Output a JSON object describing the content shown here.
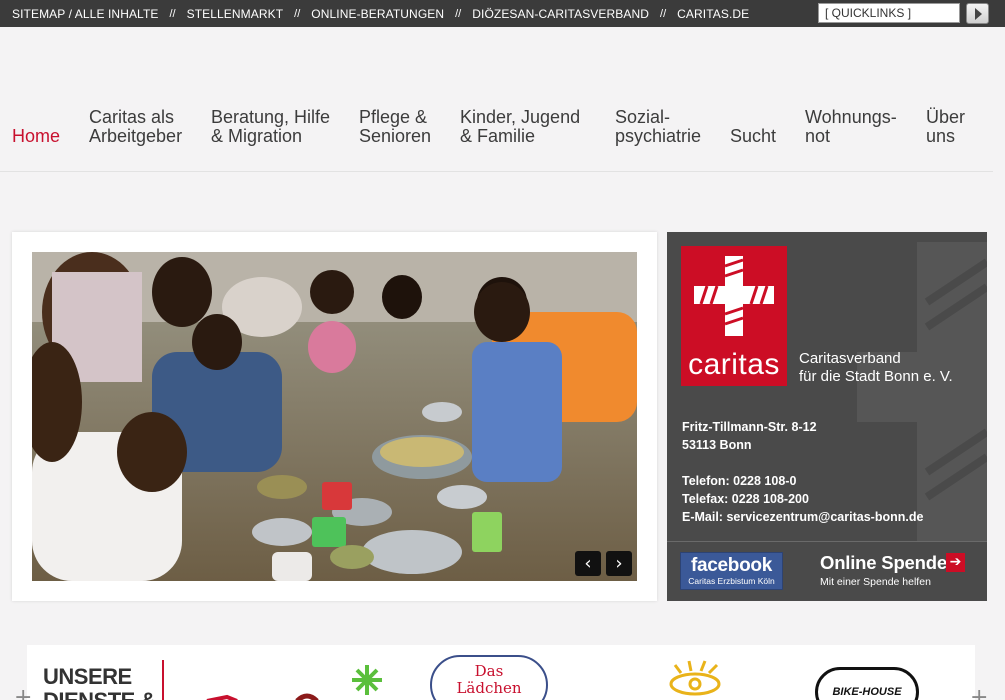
{
  "topbar": {
    "links": [
      "SITEMAP / ALLE INHALTE",
      "STELLENMARKT",
      "ONLINE-BERATUNGEN",
      "DIÖZESAN-CARITASVERBAND",
      "CARITAS.DE"
    ],
    "separator": "//",
    "quicklinks_value": "[ QUICKLINKS ]"
  },
  "nav": {
    "items": [
      {
        "line1": "Home",
        "line2": ""
      },
      {
        "line1": "Caritas als",
        "line2": "Arbeitgeber"
      },
      {
        "line1": "Beratung, Hilfe",
        "line2": "& Migration"
      },
      {
        "line1": "Pflege &",
        "line2": "Senioren"
      },
      {
        "line1": "Kinder, Jugend",
        "line2": "& Familie"
      },
      {
        "line1": "Sozial-",
        "line2": "psychiatrie"
      },
      {
        "line1": "Sucht",
        "line2": ""
      },
      {
        "line1": "Wohnungs-",
        "line2": "not"
      },
      {
        "line1": "Über",
        "line2": "uns"
      }
    ]
  },
  "slider": {
    "prev": "‹",
    "next": "›"
  },
  "info": {
    "logo_text": "caritas",
    "org_line1": "Caritasverband",
    "org_line2": "für die Stadt Bonn e. V.",
    "street": "Fritz-Tillmann-Str. 8-12",
    "city": "53113 Bonn",
    "phone": "Telefon: 0228 108-0",
    "fax": "Telefax: 0228 108-200",
    "email": "E-Mail: servicezentrum@caritas-bonn.de",
    "facebook_title": "facebook",
    "facebook_sub": "Caritas Erzbistum Köln",
    "spenden_title": "Online Spenden",
    "spenden_sub": "Mit einer Spende helfen",
    "spenden_arrow": "➔"
  },
  "bottom": {
    "heading_line1": "UNSERE",
    "heading_line2": "DIENSTE &",
    "partner_1": "Das",
    "partner_2": "Lädchen",
    "partner_3": "BIKE-HOUSE"
  },
  "colors": {
    "brand_red": "#cc0d25",
    "topbar": "#3b3b3b",
    "panel": "#4a4a4a"
  }
}
